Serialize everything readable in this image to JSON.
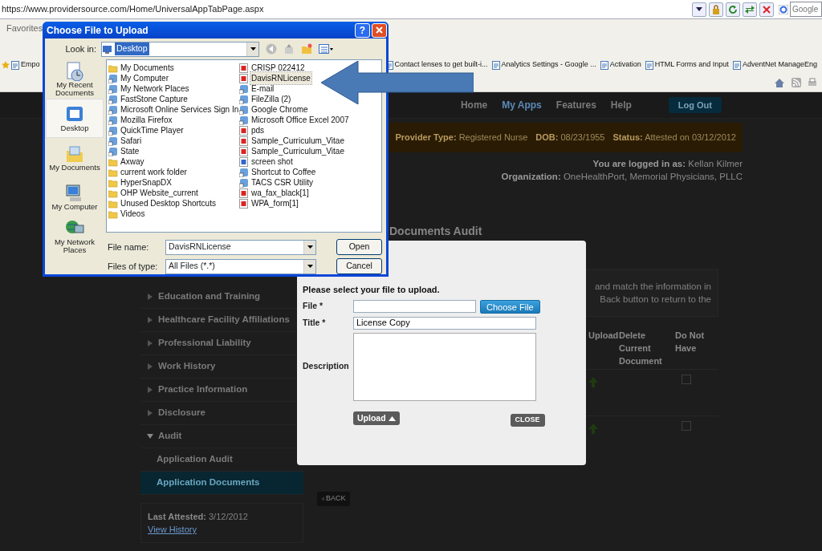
{
  "browser": {
    "url": "https://www.providersource.com/Home/UniversalAppTabPage.aspx",
    "search_placeholder": "Google",
    "favorites_label": "Favorites",
    "bookmarks": [
      {
        "label": "Empo"
      },
      {
        "label": "Contact lenses to get built-i..."
      },
      {
        "label": "Analytics Settings - Google ..."
      },
      {
        "label": "Activation"
      },
      {
        "label": "HTML Forms and Input"
      },
      {
        "label": "AdventNet ManageEng"
      }
    ]
  },
  "site_nav": {
    "links": [
      {
        "label": "Home",
        "selected": false
      },
      {
        "label": "My Apps",
        "selected": true
      },
      {
        "label": "Features",
        "selected": false
      },
      {
        "label": "Help",
        "selected": false
      }
    ],
    "logout": "Log Out"
  },
  "provider_bar": [
    {
      "label": "Provider Type:",
      "value": "Registered Nurse"
    },
    {
      "label": "DOB:",
      "value": "08/23/1955"
    },
    {
      "label": "Status:",
      "value": "Attested on 03/12/2012"
    }
  ],
  "user_info": [
    {
      "label": "You are logged in as:",
      "value": "Kellan Kilmer"
    },
    {
      "label": "Organization:",
      "value": "OneHealthPort, Memorial Physicians, PLLC"
    }
  ],
  "sidebar": {
    "items": [
      {
        "label": "Education and Training",
        "expanded": false
      },
      {
        "label": "Healthcare Facility Affiliations",
        "expanded": false
      },
      {
        "label": "Professional Liability",
        "expanded": false
      },
      {
        "label": "Work History",
        "expanded": false
      },
      {
        "label": "Practice Information",
        "expanded": false
      },
      {
        "label": "Disclosure",
        "expanded": false
      },
      {
        "label": "Audit",
        "expanded": true,
        "children": [
          {
            "label": "Application Audit",
            "selected": false
          },
          {
            "label": "Application Documents",
            "selected": true
          }
        ]
      }
    ],
    "last_attested": {
      "label": "Last Attested:",
      "value": "3/12/2012"
    },
    "history_link": "View History"
  },
  "main": {
    "heading": "Documents Audit",
    "notice_fragments": [
      "and match the information in",
      "Back button to return to the"
    ],
    "columns": [
      "Upload",
      "Delete Current Document",
      "Do Not Have"
    ],
    "rows": [
      {
        "do_not_have": false
      },
      {
        "do_not_have": false
      }
    ],
    "back_button": "BACK"
  },
  "upload_modal": {
    "prompt": "Please select your file to upload.",
    "file_label": "File *",
    "choose_button": "Choose File",
    "title_label": "Title *",
    "title_value": "License Copy",
    "description_label": "Description",
    "upload_button": "Upload",
    "close_button": "CLOSE"
  },
  "file_dialog": {
    "title": "Choose File to Upload",
    "help_button": "?",
    "look_in_label": "Look in:",
    "look_in_value": "Desktop",
    "places": [
      {
        "label": "My Recent Documents",
        "kind": "recent",
        "selected": false
      },
      {
        "label": "Desktop",
        "kind": "desktop",
        "selected": true
      },
      {
        "label": "My Documents",
        "kind": "documents",
        "selected": false
      },
      {
        "label": "My Computer",
        "kind": "computer",
        "selected": false
      },
      {
        "label": "My Network Places",
        "kind": "network",
        "selected": false
      }
    ],
    "files": [
      {
        "label": "My Documents",
        "kind": "folder",
        "selected": false
      },
      {
        "label": "My Computer",
        "kind": "app",
        "selected": false
      },
      {
        "label": "My Network Places",
        "kind": "app",
        "selected": false
      },
      {
        "label": "FastStone Capture",
        "kind": "app",
        "selected": false
      },
      {
        "label": "Microsoft Online Services Sign In",
        "kind": "app",
        "selected": false
      },
      {
        "label": "Mozilla Firefox",
        "kind": "app",
        "selected": false
      },
      {
        "label": "QuickTime Player",
        "kind": "app",
        "selected": false
      },
      {
        "label": "Safari",
        "kind": "app",
        "selected": false
      },
      {
        "label": "State",
        "kind": "app",
        "selected": false
      },
      {
        "label": "Axway",
        "kind": "folder",
        "selected": false
      },
      {
        "label": "current work folder",
        "kind": "folder",
        "selected": false
      },
      {
        "label": "HyperSnapDX",
        "kind": "folder",
        "selected": false
      },
      {
        "label": "OHP Website_current",
        "kind": "folder",
        "selected": false
      },
      {
        "label": "Unused Desktop Shortcuts",
        "kind": "folder",
        "selected": false
      },
      {
        "label": "Videos",
        "kind": "folder",
        "selected": false
      },
      {
        "label": "CRISP 022412",
        "kind": "pdf",
        "selected": false
      },
      {
        "label": "DavisRNLicense",
        "kind": "pdf",
        "selected": true
      },
      {
        "label": "E-mail",
        "kind": "app",
        "selected": false
      },
      {
        "label": "FileZilla (2)",
        "kind": "app",
        "selected": false
      },
      {
        "label": "Google Chrome",
        "kind": "app",
        "selected": false
      },
      {
        "label": "Microsoft Office Excel 2007",
        "kind": "app",
        "selected": false
      },
      {
        "label": "pds",
        "kind": "pdf",
        "selected": false
      },
      {
        "label": "Sample_Curriculum_Vitae",
        "kind": "pdf",
        "selected": false
      },
      {
        "label": "Sample_Curriculum_Vitae",
        "kind": "pdf",
        "selected": false
      },
      {
        "label": "screen shot",
        "kind": "doc",
        "selected": false
      },
      {
        "label": "Shortcut to Coffee",
        "kind": "app",
        "selected": false
      },
      {
        "label": "TACS CSR Utility",
        "kind": "app",
        "selected": false
      },
      {
        "label": "wa_fax_black[1]",
        "kind": "pdf",
        "selected": false
      },
      {
        "label": "WPA_form[1]",
        "kind": "pdf",
        "selected": false
      }
    ],
    "file_name_label": "File name:",
    "file_name_value": "DavisRNLicense",
    "file_type_label": "Files of type:",
    "file_type_value": "All Files (*.*)",
    "open_button": "Open",
    "cancel_button": "Cancel"
  }
}
